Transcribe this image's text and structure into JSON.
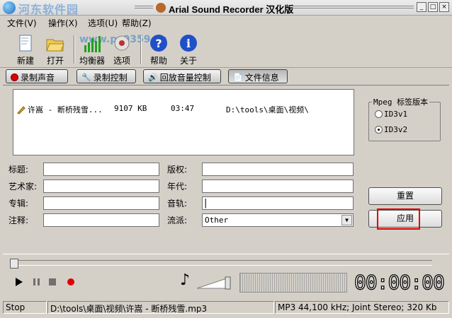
{
  "window": {
    "title": "Arial Sound Recorder 汉化版",
    "watermark": "河东软件园",
    "watermark_url": "www.pc0359.cn",
    "minimize_label": "_",
    "maximize_label": "□",
    "close_label": "×"
  },
  "menu": {
    "items": [
      "文件(V)",
      "操作(X)",
      "选项(U)",
      "帮助(Z)"
    ]
  },
  "toolbar": {
    "buttons": [
      {
        "label": "新建",
        "icon": "new-file-icon"
      },
      {
        "label": "打开",
        "icon": "open-folder-icon"
      },
      {
        "label": "均衡器",
        "icon": "equalizer-icon"
      },
      {
        "label": "选项",
        "icon": "options-icon"
      },
      {
        "label": "帮助",
        "icon": "help-icon"
      },
      {
        "label": "关于",
        "icon": "about-icon"
      }
    ]
  },
  "tabs": [
    {
      "label": "录制声音",
      "icon": "record-icon"
    },
    {
      "label": "录制控制",
      "icon": "wrench-icon"
    },
    {
      "label": "回放音量控制",
      "icon": "speaker-icon"
    },
    {
      "label": "文件信息",
      "icon": "file-info-icon",
      "active": true
    }
  ],
  "file_list": {
    "rows": [
      {
        "name": "许嵩 - 断桥残雪...",
        "size": "9107 KB",
        "duration": "03:47",
        "path": "D:\\tools\\桌面\\视频\\"
      }
    ]
  },
  "mpeg_tag": {
    "legend": "Mpeg 标签版本",
    "options": [
      "ID3v1",
      "ID3v2"
    ],
    "selected": "ID3v2"
  },
  "fields": {
    "title_label": "标题:",
    "artist_label": "艺术家:",
    "album_label": "专辑:",
    "comment_label": "注释:",
    "copyright_label": "版权:",
    "year_label": "年代:",
    "track_label": "音轨:",
    "genre_label": "流派:",
    "title_value": "",
    "artist_value": "",
    "album_value": "",
    "comment_value": "",
    "copyright_value": "",
    "year_value": "",
    "track_value": "",
    "genre_value": "Other"
  },
  "actions": {
    "reset_label": "重置",
    "apply_label": "应用"
  },
  "player": {
    "note_glyph": "♪",
    "timer": "00:00:00"
  },
  "status": {
    "state": "Stop",
    "file": "D:\\tools\\桌面\\视频\\许嵩 - 断桥残雪.mp3",
    "format": "MP3  44,100 kHz; Joint Stereo; 320 Kb"
  },
  "colors": {
    "highlight": "#e00000",
    "record": "#e00000",
    "background": "#d4d0c8"
  }
}
